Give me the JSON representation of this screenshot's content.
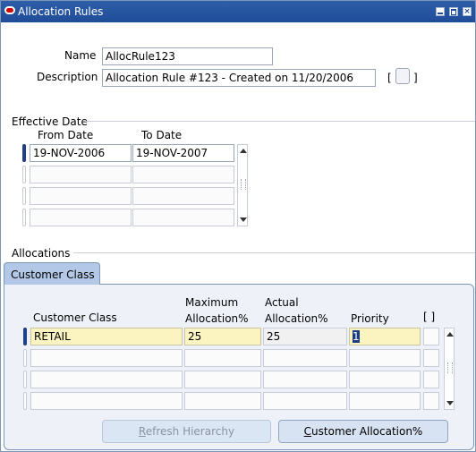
{
  "window": {
    "title": "Allocation Rules",
    "controls": [
      "minimize-icon",
      "maximize-icon",
      "close-icon"
    ]
  },
  "header": {
    "name_label": "Name",
    "name_value": "AllocRule123",
    "description_label": "Description",
    "description_value": "Allocation Rule #123 - Created on 11/20/2006",
    "bracket_open": "[",
    "bracket_close": "]"
  },
  "effective_date": {
    "section_label": "Effective Date",
    "from_label": "From Date",
    "to_label": "To Date",
    "rows": [
      {
        "from": "19-NOV-2006",
        "to": "19-NOV-2007"
      },
      {
        "from": "",
        "to": ""
      },
      {
        "from": "",
        "to": ""
      },
      {
        "from": "",
        "to": ""
      }
    ]
  },
  "allocations": {
    "section_label": "Allocations",
    "tab_label": "Customer Class",
    "columns": {
      "customer_class": "Customer Class",
      "max_line1": "Maximum",
      "max_line2": "Allocation%",
      "actual_line1": "Actual",
      "actual_line2": "Allocation%",
      "priority": "Priority",
      "flex": "[ ]"
    },
    "rows": [
      {
        "customer_class": "RETAIL",
        "max": "25",
        "actual": "25",
        "priority": "1"
      },
      {
        "customer_class": "",
        "max": "",
        "actual": "",
        "priority": ""
      },
      {
        "customer_class": "",
        "max": "",
        "actual": "",
        "priority": ""
      },
      {
        "customer_class": "",
        "max": "",
        "actual": "",
        "priority": ""
      }
    ]
  },
  "buttons": {
    "refresh_prefix": "",
    "refresh_mnemonic": "R",
    "refresh_rest": "efresh Hierarchy",
    "customer_mnemonic": "C",
    "customer_rest": "ustomer Allocation%"
  }
}
